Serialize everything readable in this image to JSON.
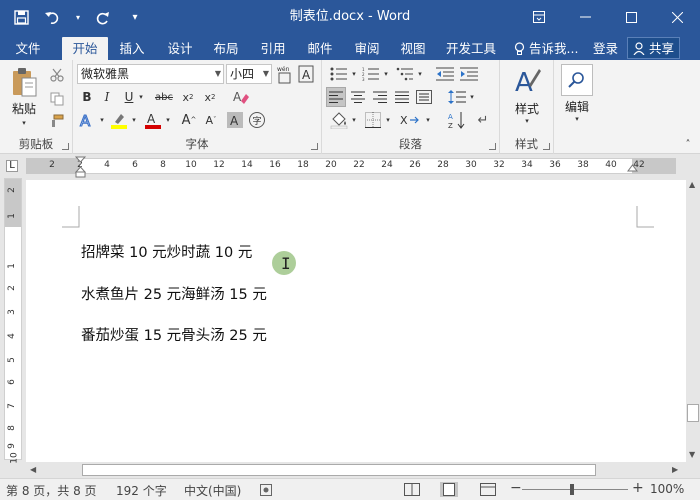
{
  "window": {
    "title": "制表位.docx - Word"
  },
  "tabs": [
    {
      "label": "文件",
      "active": false
    },
    {
      "label": "开始",
      "active": true
    },
    {
      "label": "插入",
      "active": false
    },
    {
      "label": "设计",
      "active": false
    },
    {
      "label": "布局",
      "active": false
    },
    {
      "label": "引用",
      "active": false
    },
    {
      "label": "邮件",
      "active": false
    },
    {
      "label": "审阅",
      "active": false
    },
    {
      "label": "视图",
      "active": false
    },
    {
      "label": "开发工具",
      "active": false
    }
  ],
  "tell_me": "告诉我...",
  "login_label": "登录",
  "share_label": "共享",
  "ribbon": {
    "clipboard": {
      "label": "剪贴板",
      "paste": "粘贴"
    },
    "font": {
      "label": "字体",
      "font_name": "微软雅黑",
      "font_size": "小四",
      "phonetic_icon_text": "wén"
    },
    "paragraph": {
      "label": "段落"
    },
    "styles": {
      "label": "样式",
      "styles_button": "样式"
    },
    "editing": {
      "label": "编辑",
      "edit_button": "编辑"
    }
  },
  "ruler": {
    "h_ticks": [
      "2",
      "2",
      "4",
      "6",
      "8",
      "10",
      "12",
      "14",
      "16",
      "18",
      "20",
      "22",
      "24",
      "26",
      "28",
      "30",
      "32",
      "34",
      "36",
      "38",
      "40",
      "42"
    ],
    "v_ticks": [
      "2",
      "1",
      "1",
      "2",
      "3",
      "4",
      "5",
      "6",
      "7",
      "8",
      "9",
      "10"
    ]
  },
  "document": {
    "paragraphs": [
      "招牌菜 10 元炒时蔬 10 元",
      "水煮鱼片 25 元海鲜汤 15 元",
      "番茄炒蛋 15 元骨头汤 25 元"
    ]
  },
  "status": {
    "pages": "第 8 页，共 8 页",
    "words": "192 个字",
    "language": "中文(中国)",
    "zoom": "100%"
  },
  "colors": {
    "brand": "#2b579a",
    "highlight": "#ffff00",
    "font_color": "#d40000"
  }
}
